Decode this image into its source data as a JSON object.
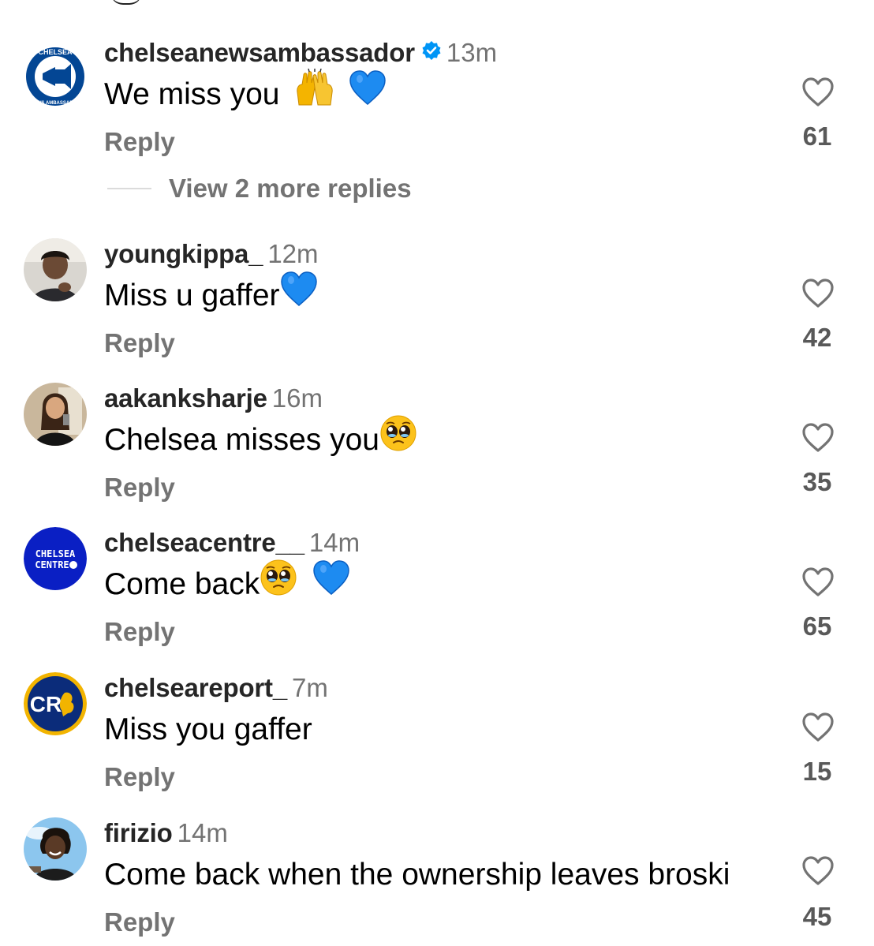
{
  "comments": [
    {
      "username": "chelseanewsambassador",
      "verified": true,
      "time": "13m",
      "text": "We miss you",
      "emojis": [
        "raised-hands",
        "blue-heart"
      ],
      "reply_label": "Reply",
      "likes": "61",
      "view_replies": "View 2 more replies",
      "avatar": "chelsea-news-ambassador-logo",
      "avatar_text": [
        "CHELSEA",
        "NEWS AMBASSADOR"
      ]
    },
    {
      "username": "youngkippa_",
      "verified": false,
      "time": "12m",
      "text": "Miss u gaffer",
      "emojis": [
        "blue-heart"
      ],
      "reply_label": "Reply",
      "likes": "42",
      "avatar": "person-photo"
    },
    {
      "username": "aakanksharje",
      "verified": false,
      "time": "16m",
      "text": "Chelsea misses you",
      "emojis": [
        "pleading-face"
      ],
      "reply_label": "Reply",
      "likes": "35",
      "avatar": "person-photo"
    },
    {
      "username": "chelseacentre__",
      "verified": false,
      "time": "14m",
      "text": "Come back",
      "emojis": [
        "pleading-face",
        "blue-heart"
      ],
      "reply_label": "Reply",
      "likes": "65",
      "avatar": "chelsea-centre-logo",
      "avatar_text": [
        "CHELSEA",
        "CENTRE"
      ]
    },
    {
      "username": "chelseareport_",
      "verified": false,
      "time": "7m",
      "text": "Miss you gaffer",
      "emojis": [],
      "reply_label": "Reply",
      "likes": "15",
      "avatar": "chelsea-report-logo",
      "avatar_text": [
        "CR"
      ]
    },
    {
      "username": "firizio",
      "verified": false,
      "time": "14m",
      "text": "Come back when the ownership leaves broski",
      "emojis": [],
      "reply_label": "Reply",
      "likes": "45",
      "avatar": "person-photo"
    }
  ],
  "colors": {
    "username": "#262626",
    "secondary_text": "#737373",
    "like_count": "#595959",
    "verified_badge": "#0095f6",
    "chelsea_blue": "#034694"
  }
}
